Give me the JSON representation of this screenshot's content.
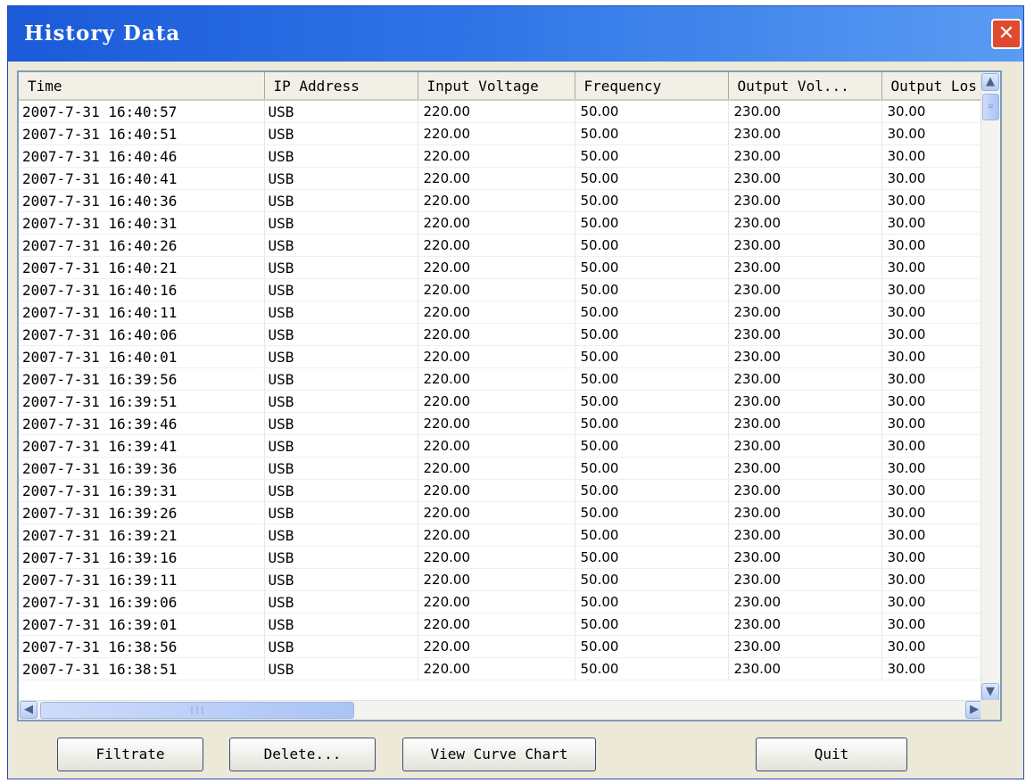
{
  "window": {
    "title": "History Data"
  },
  "table": {
    "columns": [
      "Time",
      "IP Address",
      "Input Voltage",
      "Frequency",
      "Output Vol...",
      "Output Los"
    ],
    "rows": [
      [
        "2007-7-31 16:40:57",
        "USB",
        "220.00",
        "50.00",
        "230.00",
        "30.00"
      ],
      [
        "2007-7-31 16:40:51",
        "USB",
        "220.00",
        "50.00",
        "230.00",
        "30.00"
      ],
      [
        "2007-7-31 16:40:46",
        "USB",
        "220.00",
        "50.00",
        "230.00",
        "30.00"
      ],
      [
        "2007-7-31 16:40:41",
        "USB",
        "220.00",
        "50.00",
        "230.00",
        "30.00"
      ],
      [
        "2007-7-31 16:40:36",
        "USB",
        "220.00",
        "50.00",
        "230.00",
        "30.00"
      ],
      [
        "2007-7-31 16:40:31",
        "USB",
        "220.00",
        "50.00",
        "230.00",
        "30.00"
      ],
      [
        "2007-7-31 16:40:26",
        "USB",
        "220.00",
        "50.00",
        "230.00",
        "30.00"
      ],
      [
        "2007-7-31 16:40:21",
        "USB",
        "220.00",
        "50.00",
        "230.00",
        "30.00"
      ],
      [
        "2007-7-31 16:40:16",
        "USB",
        "220.00",
        "50.00",
        "230.00",
        "30.00"
      ],
      [
        "2007-7-31 16:40:11",
        "USB",
        "220.00",
        "50.00",
        "230.00",
        "30.00"
      ],
      [
        "2007-7-31 16:40:06",
        "USB",
        "220.00",
        "50.00",
        "230.00",
        "30.00"
      ],
      [
        "2007-7-31 16:40:01",
        "USB",
        "220.00",
        "50.00",
        "230.00",
        "30.00"
      ],
      [
        "2007-7-31 16:39:56",
        "USB",
        "220.00",
        "50.00",
        "230.00",
        "30.00"
      ],
      [
        "2007-7-31 16:39:51",
        "USB",
        "220.00",
        "50.00",
        "230.00",
        "30.00"
      ],
      [
        "2007-7-31 16:39:46",
        "USB",
        "220.00",
        "50.00",
        "230.00",
        "30.00"
      ],
      [
        "2007-7-31 16:39:41",
        "USB",
        "220.00",
        "50.00",
        "230.00",
        "30.00"
      ],
      [
        "2007-7-31 16:39:36",
        "USB",
        "220.00",
        "50.00",
        "230.00",
        "30.00"
      ],
      [
        "2007-7-31 16:39:31",
        "USB",
        "220.00",
        "50.00",
        "230.00",
        "30.00"
      ],
      [
        "2007-7-31 16:39:26",
        "USB",
        "220.00",
        "50.00",
        "230.00",
        "30.00"
      ],
      [
        "2007-7-31 16:39:21",
        "USB",
        "220.00",
        "50.00",
        "230.00",
        "30.00"
      ],
      [
        "2007-7-31 16:39:16",
        "USB",
        "220.00",
        "50.00",
        "230.00",
        "30.00"
      ],
      [
        "2007-7-31 16:39:11",
        "USB",
        "220.00",
        "50.00",
        "230.00",
        "30.00"
      ],
      [
        "2007-7-31 16:39:06",
        "USB",
        "220.00",
        "50.00",
        "230.00",
        "30.00"
      ],
      [
        "2007-7-31 16:39:01",
        "USB",
        "220.00",
        "50.00",
        "230.00",
        "30.00"
      ],
      [
        "2007-7-31 16:38:56",
        "USB",
        "220.00",
        "50.00",
        "230.00",
        "30.00"
      ],
      [
        "2007-7-31 16:38:51",
        "USB",
        "220.00",
        "50.00",
        "230.00",
        "30.00"
      ]
    ]
  },
  "buttons": {
    "filtrate": "Filtrate",
    "delete": "Delete...",
    "view_curve_chart": "View Curve Chart",
    "quit": "Quit"
  },
  "icons": {
    "close": "close-icon",
    "scroll_up": "chevron-up-icon",
    "scroll_down": "chevron-down-icon",
    "scroll_left": "chevron-left-icon",
    "scroll_right": "chevron-right-icon"
  }
}
